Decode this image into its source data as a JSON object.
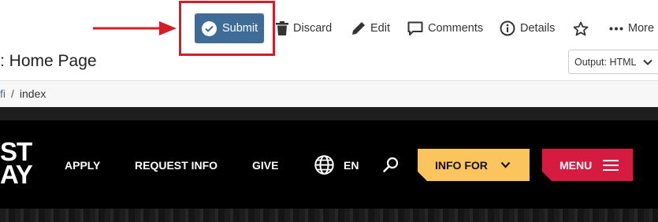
{
  "toolbar": {
    "submit_label": "Submit",
    "discard_label": "Discard",
    "edit_label": "Edit",
    "comments_label": "Comments",
    "details_label": "Details",
    "more_label": "More"
  },
  "page": {
    "title": ": Home Page",
    "output_select": "Output: HTML"
  },
  "breadcrumb": {
    "parent": "fi",
    "separator": "/",
    "current": "index"
  },
  "site": {
    "logo_line1": "ST",
    "logo_line2": "AY",
    "nav": {
      "apply": "APPLY",
      "request_info": "REQUEST INFO",
      "give": "GIVE"
    },
    "language": "EN",
    "info_for": "INFO FOR",
    "menu": "MENU"
  },
  "colors": {
    "submit_blue": "#3f6c96",
    "highlight_red": "#d21f27",
    "info_yellow": "#fcc45d",
    "menu_red": "#d71a3f"
  },
  "icons": [
    "arrow-right-icon",
    "check-circle-icon",
    "trash-icon",
    "pencil-icon",
    "comment-icon",
    "info-circle-icon",
    "star-icon",
    "ellipsis-icon",
    "chevron-down-icon",
    "globe-icon",
    "search-icon",
    "hamburger-icon"
  ]
}
